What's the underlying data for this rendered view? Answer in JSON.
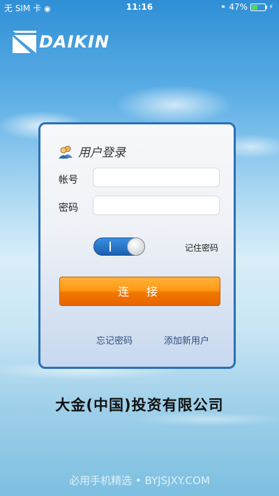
{
  "status_bar": {
    "carrier": "无 SIM 卡",
    "time": "11:16",
    "battery_percent": "47%",
    "battery_level": 0.47,
    "icons": [
      "wifi-icon",
      "orientation-lock-icon",
      "battery-icon",
      "charging-bolt-icon"
    ]
  },
  "brand": {
    "logo_text": "DAIKIN",
    "accent": "#1a6fc4"
  },
  "login": {
    "title": "用户登录",
    "account_label": "帐号",
    "account_value": "",
    "password_label": "密码",
    "password_value": "",
    "remember_toggle": "on",
    "remember_label": "记住密码",
    "connect_label": "连 接",
    "forgot_link": "忘记密码",
    "add_user_link": "添加新用户"
  },
  "company_name": "大金(中国)投资有限公司",
  "watermark": "必用手机精选 • BYJSJXY.COM",
  "colors": {
    "card_border": "#2a6fb8",
    "button": "#f07800",
    "toggle": "#2a78d0"
  }
}
